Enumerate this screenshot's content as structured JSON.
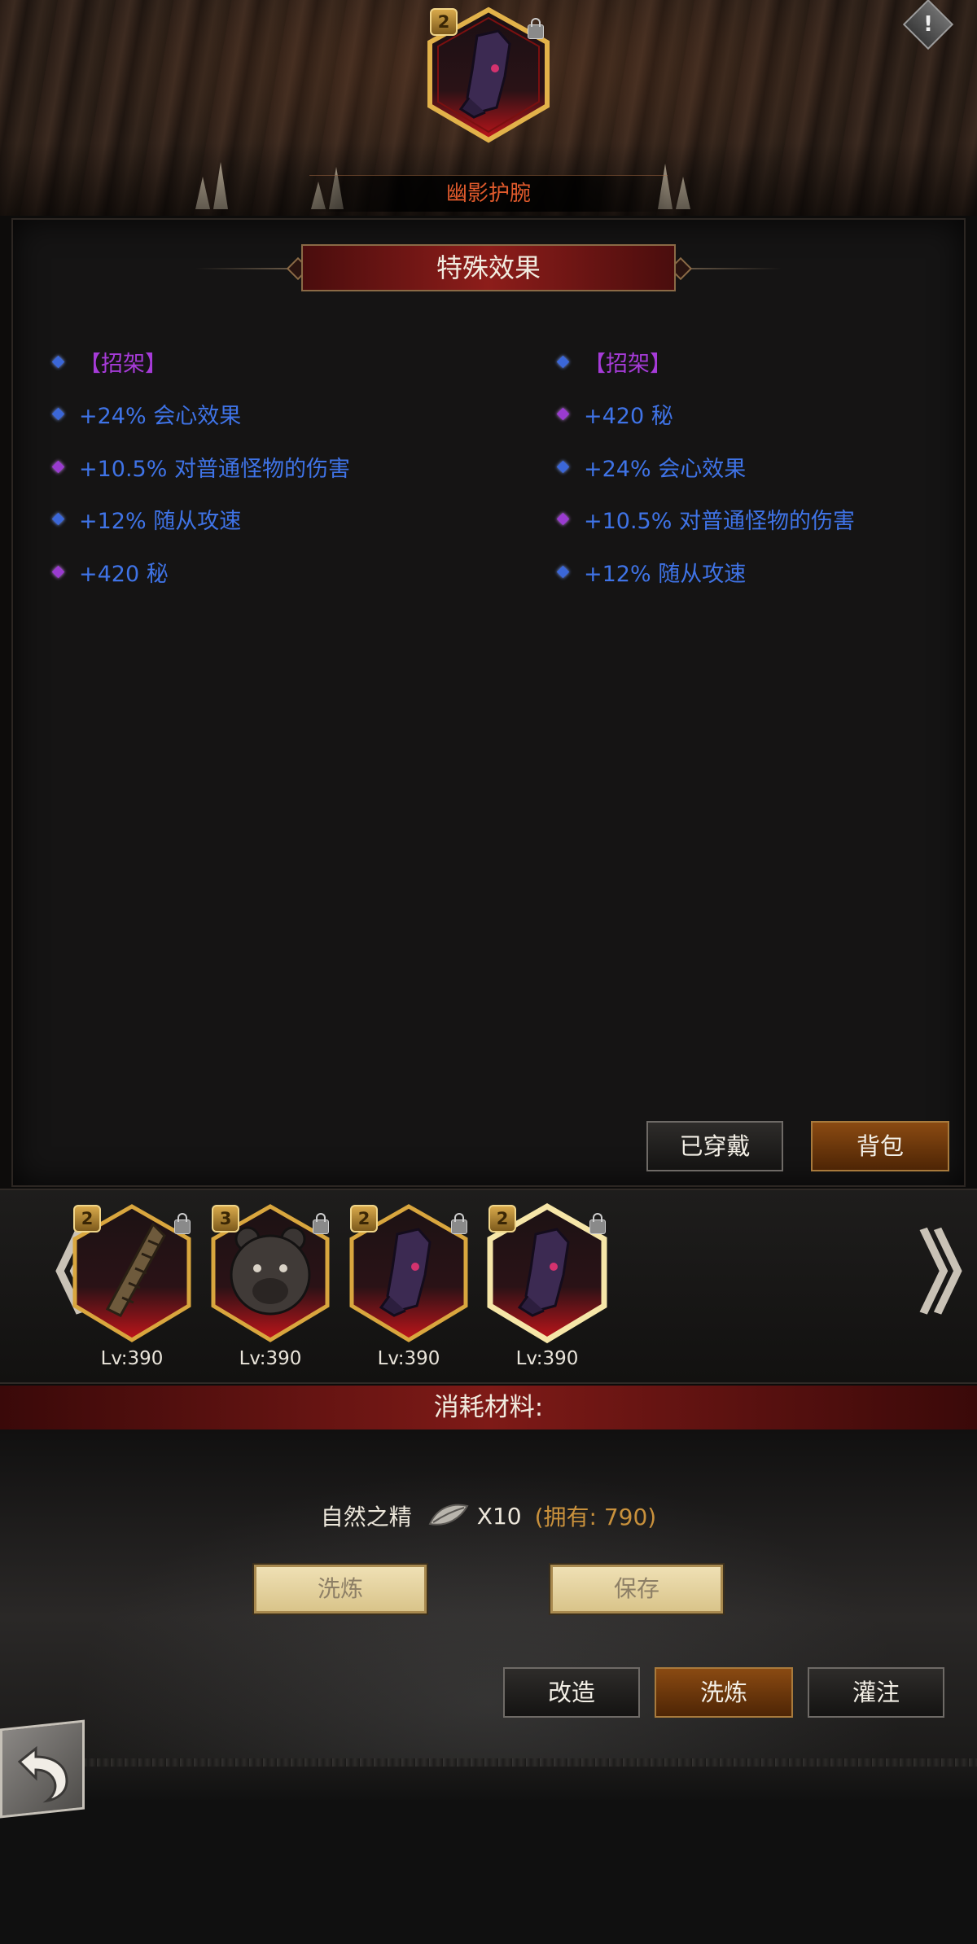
{
  "item": {
    "name": "幽影护腕",
    "level_badge": "2"
  },
  "section": {
    "title": "特殊效果"
  },
  "effects": {
    "left": [
      {
        "text": "【招架】",
        "color": "purple",
        "gem": "blue"
      },
      {
        "text": "+24% 会心效果",
        "color": "blue",
        "gem": "blue"
      },
      {
        "text": "+10.5% 对普通怪物的伤害",
        "color": "blue",
        "gem": "purple"
      },
      {
        "text": "+12% 随从攻速",
        "color": "blue",
        "gem": "blue"
      },
      {
        "text": "+420 秘",
        "color": "blue",
        "gem": "purple"
      }
    ],
    "right": [
      {
        "text": "【招架】",
        "color": "purple",
        "gem": "blue"
      },
      {
        "text": "+420 秘",
        "color": "blue",
        "gem": "purple"
      },
      {
        "text": "+24% 会心效果",
        "color": "blue",
        "gem": "blue"
      },
      {
        "text": "+10.5% 对普通怪物的伤害",
        "color": "blue",
        "gem": "purple"
      },
      {
        "text": "+12% 随从攻速",
        "color": "blue",
        "gem": "blue"
      }
    ]
  },
  "tabs": {
    "equipped_label": "已穿戴",
    "backpack_label": "背包"
  },
  "carousel": {
    "items": [
      {
        "icon": "bandage-wrap-icon",
        "badge": "2",
        "level": "Lv:390"
      },
      {
        "icon": "bear-head-icon",
        "badge": "3",
        "level": "Lv:390"
      },
      {
        "icon": "shadow-gauntlet-icon",
        "badge": "2",
        "level": "Lv:390"
      },
      {
        "icon": "shadow-gauntlet-icon",
        "badge": "2",
        "level": "Lv:390",
        "selected": true
      }
    ],
    "prev_arrow": "《",
    "next_arrow": "》"
  },
  "materials": {
    "title": "消耗材料:",
    "name": "自然之精",
    "icon": "leaf-essence-icon",
    "quantity": "X10",
    "owned": "(拥有: 790)"
  },
  "actions": {
    "refine_label": "洗炼",
    "save_label": "保存"
  },
  "bottom_tabs": {
    "reforge_label": "改造",
    "refine_label": "洗炼",
    "infuse_label": "灌注"
  },
  "colors": {
    "effect_blue": "#3f73e6",
    "effect_purple": "#a63bd8",
    "title_red": "#e05a2c",
    "owned_gold": "#c9913c",
    "active_tab": "#8a4a12"
  }
}
